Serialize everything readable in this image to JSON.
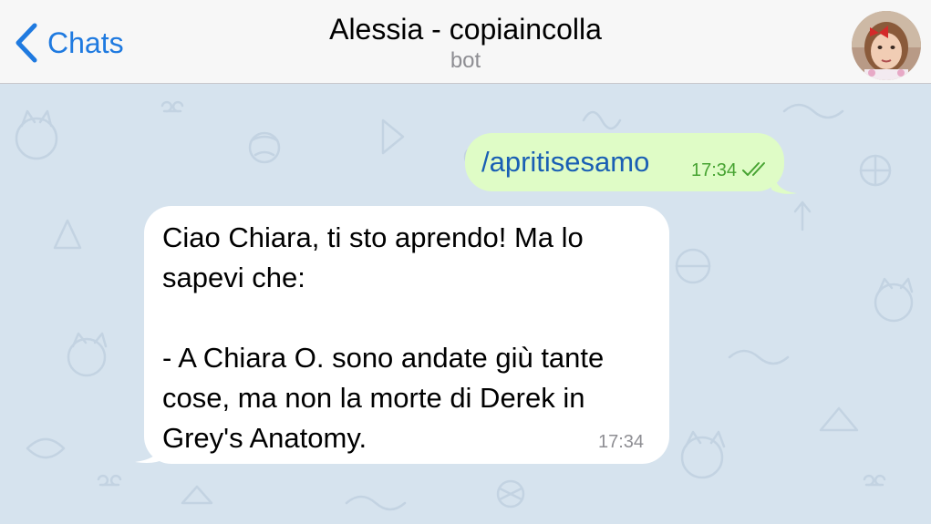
{
  "header": {
    "back_label": "Chats",
    "title": "Alessia - copiaincolla",
    "subtitle": "bot"
  },
  "messages": [
    {
      "direction": "outgoing",
      "text": "/apritisesamo",
      "time": "17:34",
      "status": "read"
    },
    {
      "direction": "incoming",
      "text": "Ciao Chiara, ti sto aprendo! Ma lo\nsapevi che:\n\n- A Chiara O. sono andate giù tante\ncose, ma non la morte di Derek in\nGrey's Anatomy.",
      "time": "17:34"
    }
  ],
  "colors": {
    "accent": "#1f7ae0",
    "chat_background": "#d6e3ee",
    "outgoing_bubble": "#dffcc6",
    "incoming_bubble": "#ffffff",
    "read_ticks": "#47a332"
  }
}
